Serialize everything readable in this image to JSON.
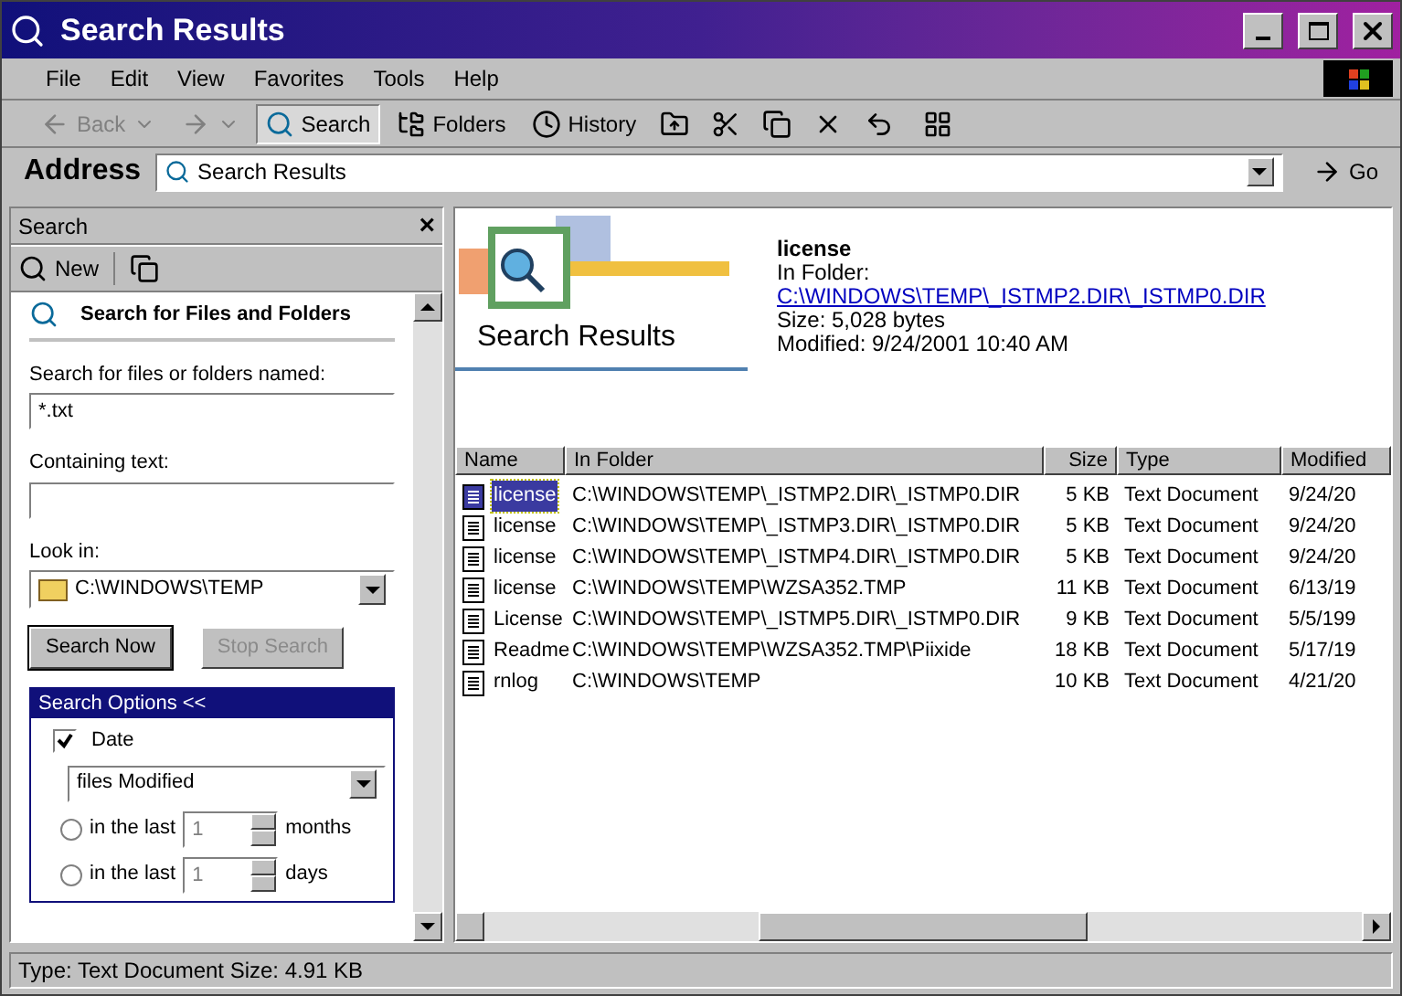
{
  "window": {
    "title": "Search Results"
  },
  "menu": [
    "File",
    "Edit",
    "View",
    "Favorites",
    "Tools",
    "Help"
  ],
  "toolbar": [
    {
      "kind": "back",
      "label": "Back",
      "disabled": true,
      "selected": false
    },
    {
      "kind": "forward",
      "disabled": true,
      "selected": false
    },
    {
      "kind": "search",
      "label": "Search",
      "disabled": false,
      "selected": true
    },
    {
      "kind": "folders",
      "label": "Folders",
      "disabled": false,
      "selected": false
    },
    {
      "kind": "history",
      "label": "History",
      "disabled": false,
      "selected": false
    }
  ],
  "address": {
    "label": "Address",
    "value": "Search Results",
    "go": "Go"
  },
  "search_pane": {
    "title": "Search",
    "close": "×",
    "new": "New",
    "heading": "Search for Files and Folders",
    "name_label": "Search for files or folders named:",
    "name_value": "*.txt",
    "containing_label": "Containing text:",
    "look_in_label": "Look in:",
    "look_in_value": "C:\\WINDOWS\\TEMP",
    "buttons": [
      {
        "label": "Search Now",
        "disabled": false
      },
      {
        "label": "Stop Search",
        "disabled": true
      }
    ],
    "options": {
      "title": "Search Options <<",
      "date": {
        "label": "Date",
        "checked": true
      },
      "date_type": "files Modified",
      "ranges": [
        {
          "label": "in the last",
          "value": "1",
          "unit": "months",
          "selected": false
        },
        {
          "label": "in the last",
          "value": "1",
          "unit": "days",
          "selected": false
        }
      ]
    }
  },
  "preview": {
    "banner": "Search Results",
    "name": "license",
    "in_folder_label": "In Folder:",
    "folder_link": "C:\\WINDOWS\\TEMP\\_ISTMP2.DIR\\_ISTMP0.DIR",
    "size": "Size: 5,028 bytes",
    "modified": "Modified: 9/24/2001 10:40 AM"
  },
  "table": {
    "columns": [
      "Name",
      "In Folder",
      "Size",
      "Type",
      "Modified"
    ],
    "rows": [
      {
        "name": "license",
        "folder": "C:\\WINDOWS\\TEMP\\_ISTMP2.DIR\\_ISTMP0.DIR",
        "size": "5 KB",
        "type": "Text Document",
        "modified": "9/24/20",
        "selected": true
      },
      {
        "name": "license",
        "folder": "C:\\WINDOWS\\TEMP\\_ISTMP3.DIR\\_ISTMP0.DIR",
        "size": "5 KB",
        "type": "Text Document",
        "modified": "9/24/20",
        "selected": false
      },
      {
        "name": "license",
        "folder": "C:\\WINDOWS\\TEMP\\_ISTMP4.DIR\\_ISTMP0.DIR",
        "size": "5 KB",
        "type": "Text Document",
        "modified": "9/24/20",
        "selected": false
      },
      {
        "name": "license",
        "folder": "C:\\WINDOWS\\TEMP\\WZSA352.TMP",
        "size": "11 KB",
        "type": "Text Document",
        "modified": "6/13/19",
        "selected": false
      },
      {
        "name": "License",
        "folder": "C:\\WINDOWS\\TEMP\\_ISTMP5.DIR\\_ISTMP0.DIR",
        "size": "9 KB",
        "type": "Text Document",
        "modified": "5/5/199",
        "selected": false
      },
      {
        "name": "Readme",
        "folder": "C:\\WINDOWS\\TEMP\\WZSA352.TMP\\Piixide",
        "size": "18 KB",
        "type": "Text Document",
        "modified": "5/17/19",
        "selected": false
      },
      {
        "name": "rnlog",
        "folder": "C:\\WINDOWS\\TEMP",
        "size": "10 KB",
        "type": "Text Document",
        "modified": "4/21/20",
        "selected": false
      }
    ]
  },
  "status_bar": "Type: Text Document Size: 4.91 KB"
}
